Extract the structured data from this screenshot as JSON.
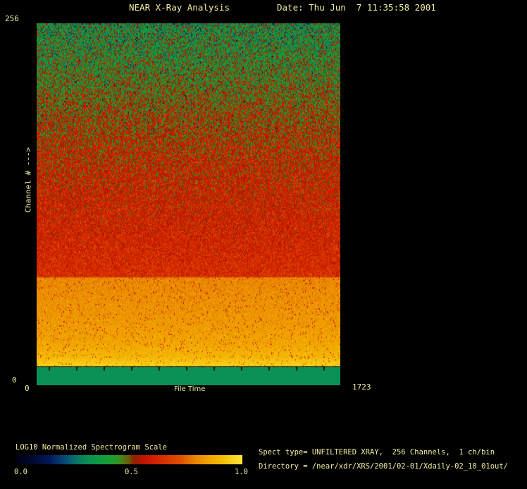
{
  "window": {
    "bg_color": "#000000",
    "text_color": "#f2eca0"
  },
  "header": {
    "title": "NEAR X-Ray Analysis",
    "date": "Date: Thu Jun  7 11:35:58 2001"
  },
  "plot": {
    "y_axis": {
      "label": "Channel # --->",
      "max_tick": "256",
      "min_tick": "0"
    },
    "x_axis": {
      "label": "File Time",
      "min_tick": "0",
      "max_tick": "1723"
    }
  },
  "colorbar": {
    "label": "LOG10 Normalized Spectrogram Scale",
    "tick_labels": [
      "0.0",
      "0.5",
      "1.0"
    ]
  },
  "info": {
    "spect_type": "Spect type= UNFILTERED XRAY,  256 Channels,  1 ch/bin",
    "directory": "Directory = /near/xdr/XRS/2001/02-01/Xdaily-02_10_01out/"
  },
  "chart_data": {
    "type": "heatmap",
    "title": "NEAR X-Ray Analysis",
    "xlabel": "File Time",
    "ylabel": "Channel #",
    "x_range": [
      0,
      1723
    ],
    "y_range": [
      0,
      256
    ],
    "colorbar": {
      "label": "LOG10 Normalized Spectrogram Scale",
      "range": [
        0.0,
        1.0
      ],
      "tick_labels": [
        "0.0",
        "0.5",
        "1.0"
      ]
    },
    "colormap_stops": [
      {
        "t": 0.0,
        "color": "#000010"
      },
      {
        "t": 0.07,
        "color": "#00082e"
      },
      {
        "t": 0.15,
        "color": "#02185a"
      },
      {
        "t": 0.21,
        "color": "#064472"
      },
      {
        "t": 0.26,
        "color": "#076e6e"
      },
      {
        "t": 0.31,
        "color": "#0a8c55"
      },
      {
        "t": 0.37,
        "color": "#0f9a40"
      },
      {
        "t": 0.42,
        "color": "#18a032"
      },
      {
        "t": 0.46,
        "color": "#3c8c1e"
      },
      {
        "t": 0.5,
        "color": "#6e5a0a"
      },
      {
        "t": 0.52,
        "color": "#8c2300"
      },
      {
        "t": 0.56,
        "color": "#bc1400"
      },
      {
        "t": 0.61,
        "color": "#d21e00"
      },
      {
        "t": 0.67,
        "color": "#d83800"
      },
      {
        "t": 0.73,
        "color": "#e05200"
      },
      {
        "t": 0.8,
        "color": "#ea8a04"
      },
      {
        "t": 0.87,
        "color": "#f2ac02"
      },
      {
        "t": 0.93,
        "color": "#f6c60e"
      },
      {
        "t": 1.0,
        "color": "#fde53a"
      }
    ],
    "bands": [
      {
        "channels": [
          154,
          256
        ],
        "appearance": "noisy green with dark navy/black specks, occasional red; intensity ~0.38-0.52 rising toward lower channels"
      },
      {
        "channels": [
          77,
          154
        ],
        "appearance": "noisy red/orange-red with green specks; intensity ~0.55-0.65"
      },
      {
        "channels": [
          13,
          77
        ],
        "appearance": "abrupt bright orange band, brightening to yellow toward channel ~13; intensity ~0.80-0.97"
      },
      {
        "channels": [
          0,
          13
        ],
        "appearance": "flat sea-green background strip with small black x-axis ticks"
      }
    ],
    "intensity_profile": [
      {
        "t": 0.0,
        "base": 0.38,
        "amp": 0.26
      },
      {
        "t": 0.12,
        "base": 0.44,
        "amp": 0.24
      },
      {
        "t": 0.25,
        "base": 0.52,
        "amp": 0.21
      },
      {
        "t": 0.38,
        "base": 0.57,
        "amp": 0.18
      },
      {
        "t": 0.5,
        "base": 0.6,
        "amp": 0.15
      },
      {
        "t": 0.62,
        "base": 0.625,
        "amp": 0.125
      },
      {
        "t": 0.698,
        "base": 0.645,
        "amp": 0.11
      },
      {
        "t": 0.702,
        "base": 0.8,
        "amp": 0.05
      },
      {
        "t": 0.82,
        "base": 0.83,
        "amp": 0.05
      },
      {
        "t": 0.88,
        "base": 0.855,
        "amp": 0.045
      },
      {
        "t": 0.92,
        "base": 0.895,
        "amp": 0.04
      },
      {
        "t": 0.948,
        "base": 0.965,
        "amp": 0.025
      }
    ],
    "strip": {
      "top_fraction": 0.949,
      "color": "#0b9156",
      "boundary_color": "#5a2604",
      "tick_color": "#02140c"
    }
  }
}
